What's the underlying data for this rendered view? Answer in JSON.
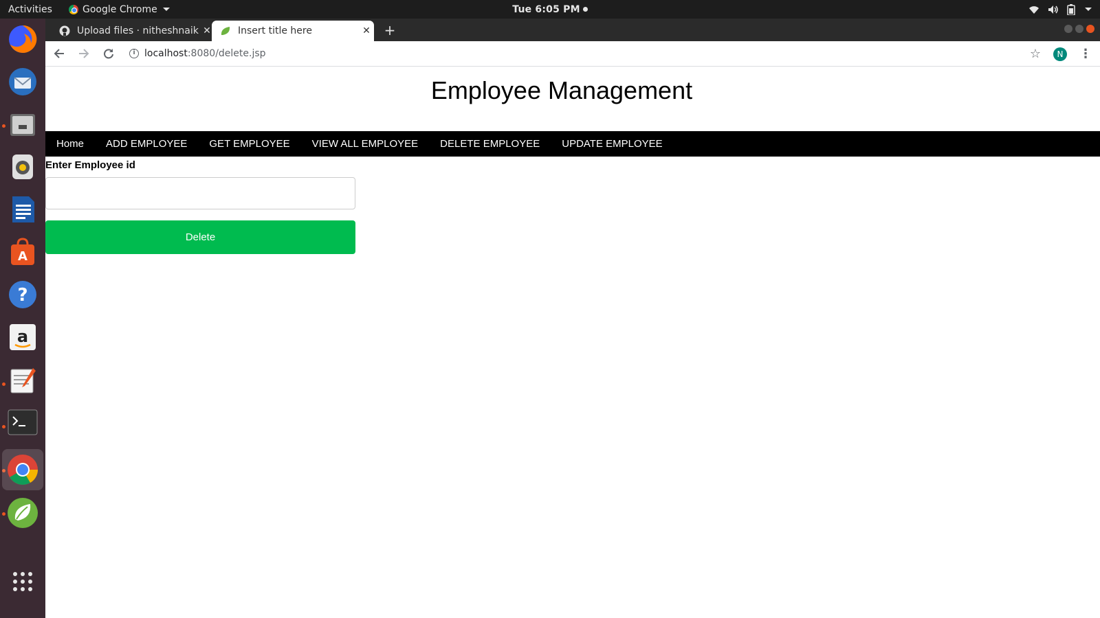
{
  "system_bar": {
    "activities": "Activities",
    "app_name": "Google Chrome",
    "clock": "Tue  6:05 PM"
  },
  "browser": {
    "tabs": [
      {
        "title": "Upload files · nitheshnaik",
        "favicon": "github-icon",
        "active": false
      },
      {
        "title": "Insert title here",
        "favicon": "leaf-icon",
        "active": true
      }
    ],
    "url_host": "localhost",
    "url_rest": ":8080/delete.jsp",
    "profile_initial": "N",
    "colors": {
      "profile": "#00897b"
    }
  },
  "dock": {
    "apps": [
      "firefox-icon",
      "thunderbird-icon",
      "files-icon",
      "rhythmbox-icon",
      "libreoffice-writer-icon",
      "software-center-icon",
      "help-icon",
      "amazon-icon",
      "text-editor-icon",
      "terminal-icon",
      "chrome-icon",
      "spring-tool-suite-icon",
      "show-apps-icon"
    ]
  },
  "page": {
    "title": "Employee Management",
    "nav": [
      "Home",
      "ADD EMPLOYEE",
      "GET EMPLOYEE",
      "VIEW ALL EMPLOYEE",
      "DELETE EMPLOYEE",
      "UPDATE EMPLOYEE"
    ],
    "form": {
      "label": "Enter Employee id",
      "value": "",
      "button": "Delete"
    },
    "colors": {
      "navbar": "#000000",
      "button": "#00bb4f"
    }
  }
}
